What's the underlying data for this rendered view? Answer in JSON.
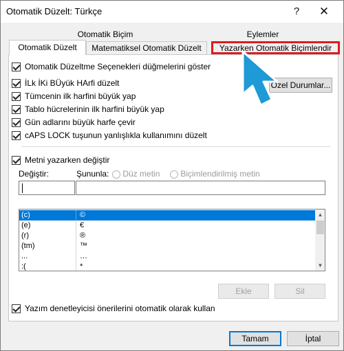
{
  "window": {
    "title": "Otomatik Düzelt: Türkçe",
    "help": "?",
    "close": "✕"
  },
  "tabs": {
    "row1": [
      {
        "label": "Otomatik Biçim"
      },
      {
        "label": "Eylemler"
      }
    ],
    "row2": [
      {
        "label": "Otomatik Düzelt",
        "active": true
      },
      {
        "label": "Matematiksel Otomatik Düzelt"
      },
      {
        "label": "Yazarken Otomatik Biçimlendir",
        "highlighted": true
      }
    ]
  },
  "options": {
    "show_buttons": "Otomatik Düzeltme Seçenekleri düğmelerini göster",
    "two_initial_caps": "İLk İKi BÜyük HArfi düzelt",
    "first_letter_sentence": "Tümcenin ilk harfini büyük yap",
    "first_letter_table": "Tablo hücrelerinin ilk harfini büyük yap",
    "day_names": "Gün adlarını büyük harfe çevir",
    "caps_lock": "cAPS LOCK tuşunun yanlışlıkla kullanımını düzelt",
    "exceptions_button": "Özel Durumlar..."
  },
  "replace": {
    "checkbox": "Metni yazarken değiştir",
    "replace_label": "Değiştir:",
    "with_label": "Sunun̲la:",
    "with_label_text": "Şununla:",
    "plain_text": "Düz metin",
    "formatted_text": "Biçimlendirilmiş metin",
    "replace_value": "",
    "with_value": ""
  },
  "entries": [
    {
      "from": "(c)",
      "to": "©",
      "selected": true
    },
    {
      "from": "(e)",
      "to": "€"
    },
    {
      "from": "(r)",
      "to": "®"
    },
    {
      "from": "(tm)",
      "to": "™"
    },
    {
      "from": "...",
      "to": "…"
    },
    {
      "from": ":(",
      "to": "*"
    }
  ],
  "buttons": {
    "add": "Ekle",
    "delete": "Sil",
    "ok": "Tamam",
    "cancel": "İptal"
  },
  "spelling": "Yazım denetleyicisi önerilerini otomatik olarak kullan",
  "colors": {
    "accent": "#0078d7",
    "highlight_border": "#e01b1b",
    "arrow": "#1e9ad6"
  }
}
